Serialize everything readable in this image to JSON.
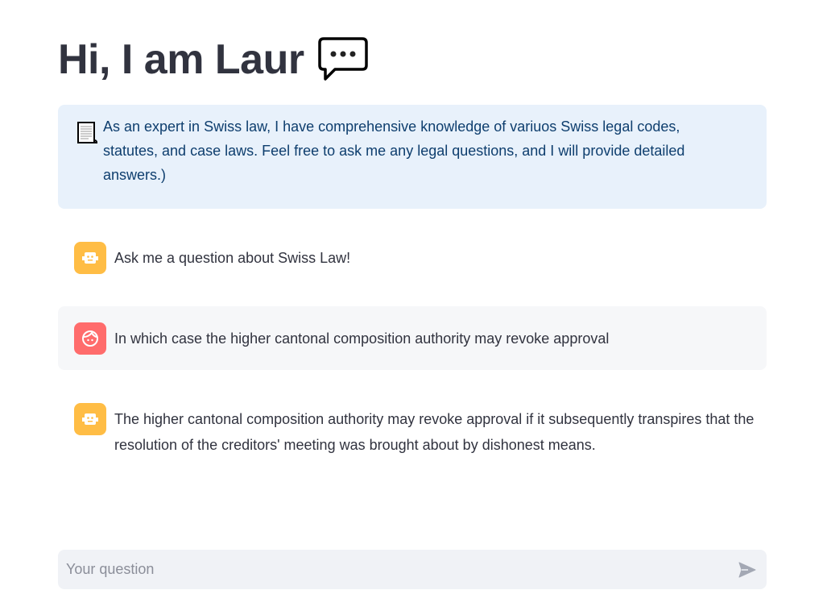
{
  "header": {
    "title": "Hi, I am Laur",
    "title_icon": "speech-bubble-icon"
  },
  "intro": {
    "icon": "page-scroll-icon",
    "text": "As an expert in Swiss law, I have comprehensive knowledge of variuos Swiss legal codes, statutes, and case laws. Feel free to ask me any legal questions, and I will provide detailed answers.)"
  },
  "messages": [
    {
      "role": "assistant",
      "avatar": "robot-icon",
      "text": "Ask me a question about Swiss Law!"
    },
    {
      "role": "user",
      "avatar": "user-face-icon",
      "text": "In which case the higher cantonal composition authority may revoke approval"
    },
    {
      "role": "assistant",
      "avatar": "robot-icon",
      "text": "The higher cantonal composition authority may revoke approval if it subsequently transpires that the resolution of the creditors' meeting was brought about by dishonest means."
    }
  ],
  "chat_input": {
    "placeholder": "Your question",
    "value": "",
    "send_icon": "send-icon"
  },
  "colors": {
    "bot_avatar": "#ffbd45",
    "user_avatar": "#ff6c6c",
    "info_bg": "#e8f1fb",
    "input_bg": "#f0f2f6"
  }
}
